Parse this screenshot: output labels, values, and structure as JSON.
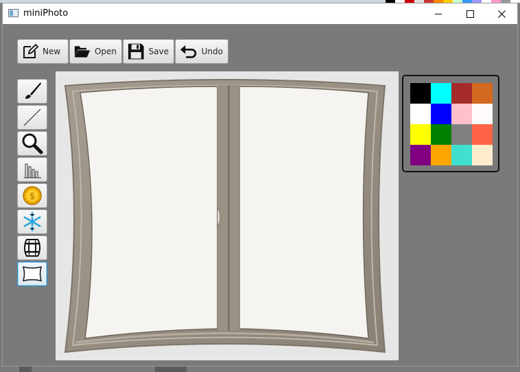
{
  "window": {
    "title": "miniPhoto"
  },
  "window_controls": {
    "minimize": "minimize-icon",
    "maximize": "maximize-icon",
    "close": "close-icon"
  },
  "toolbar": {
    "new_label": "New",
    "open_label": "Open",
    "save_label": "Save",
    "undo_label": "Undo"
  },
  "tools": [
    {
      "id": "brush",
      "icon": "paintbrush-icon"
    },
    {
      "id": "line",
      "icon": "line-icon"
    },
    {
      "id": "zoom",
      "icon": "magnifier-icon"
    },
    {
      "id": "histogram",
      "icon": "bar-chart-icon"
    },
    {
      "id": "coin",
      "icon": "coin-icon"
    },
    {
      "id": "freeze",
      "icon": "snowflake-icon"
    },
    {
      "id": "barrel",
      "icon": "barrel-icon"
    },
    {
      "id": "pillow",
      "icon": "pillow-distortion-icon",
      "selected": true
    }
  ],
  "palette": {
    "colors": [
      "#000000",
      "#00ffff",
      "#a52a2a",
      "#d2691e",
      "#ffffff",
      "#0000ff",
      "#ffc0cb",
      "#fffafa",
      "#ffff00",
      "#008000",
      "#808080",
      "#ff6347",
      "#800080",
      "#ffa500",
      "#40e0d0",
      "#ffebcd"
    ]
  },
  "canvas": {
    "image": "window-frame-image"
  }
}
